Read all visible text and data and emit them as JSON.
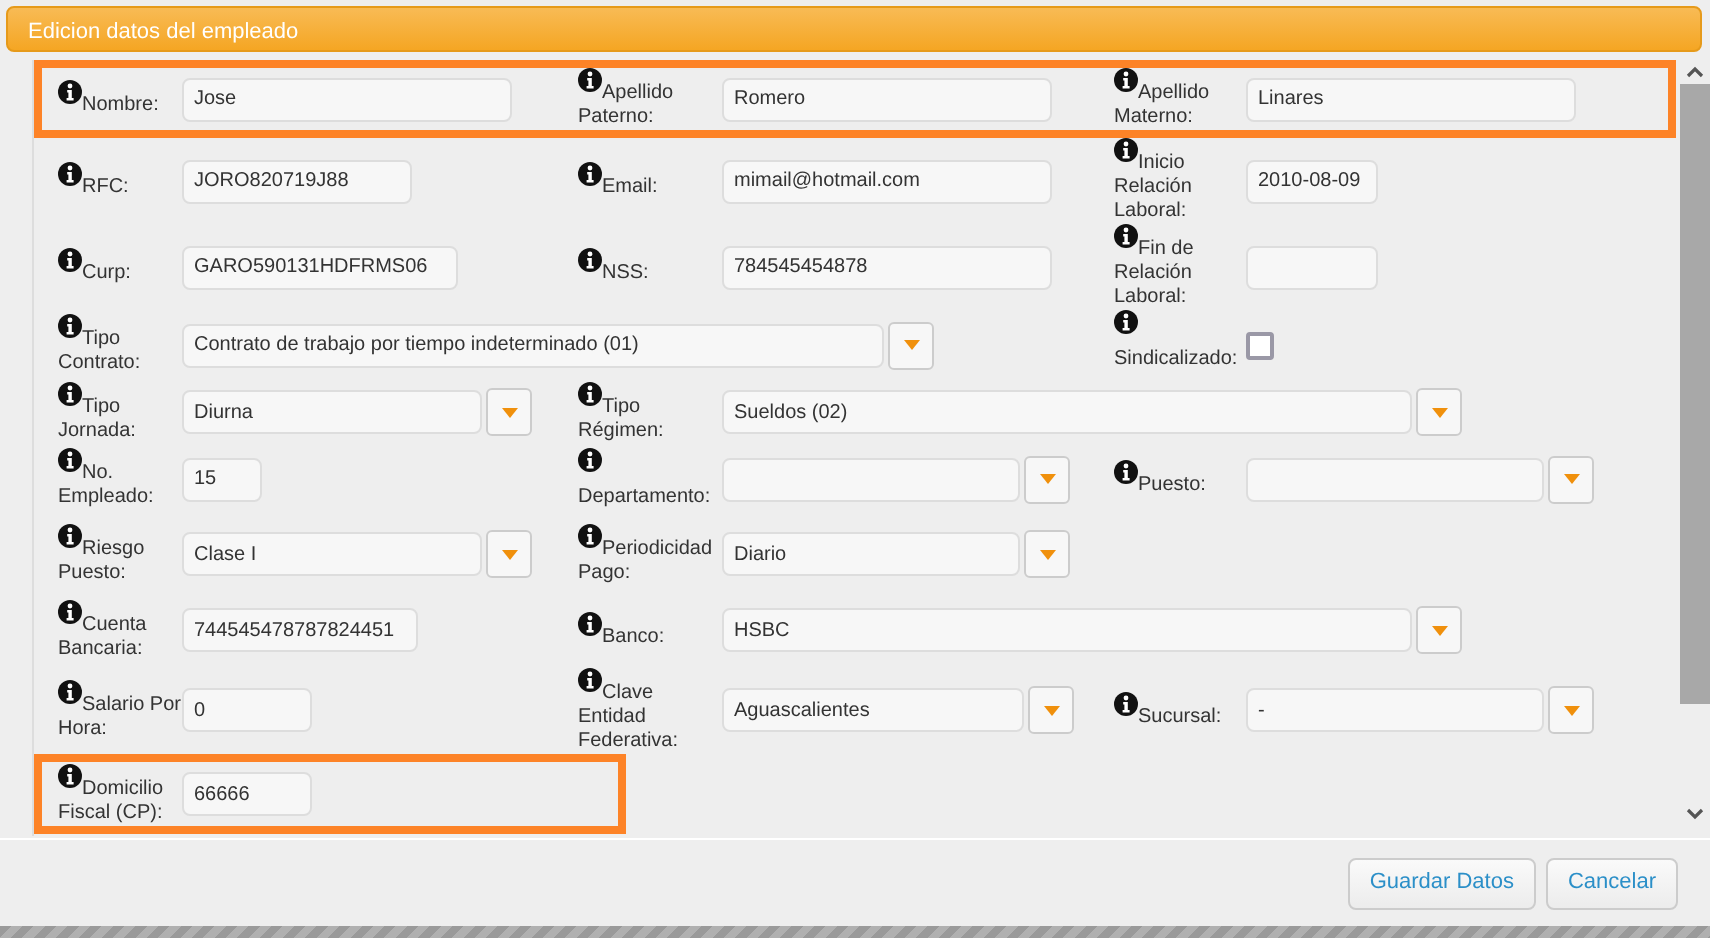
{
  "dialog": {
    "title": "Edicion datos del empleado"
  },
  "rows": [
    {
      "highlighted": true,
      "fields": [
        {
          "kind": "text",
          "label": "Nombre:",
          "value": "Jose"
        },
        {
          "kind": "text",
          "label": "Apellido Paterno:",
          "value": "Romero"
        },
        {
          "kind": "text",
          "label": "Apellido Materno:",
          "value": "Linares"
        }
      ]
    },
    {
      "highlighted": false,
      "fields": [
        {
          "kind": "text",
          "label": "RFC:",
          "value": "JORO820719J88"
        },
        {
          "kind": "text",
          "label": "Email:",
          "value": "mimail@hotmail.com"
        },
        {
          "kind": "text",
          "label": "Inicio Relación Laboral:",
          "value": "2010-08-09"
        }
      ]
    },
    {
      "highlighted": false,
      "fields": [
        {
          "kind": "text",
          "label": "Curp:",
          "value": "GARO590131HDFRMS06"
        },
        {
          "kind": "text",
          "label": "NSS:",
          "value": "784545454878"
        },
        {
          "kind": "text",
          "label": "Fin de Relación Laboral:"
        }
      ]
    },
    {
      "highlighted": false,
      "fields": [
        {
          "kind": "select",
          "label": "Tipo Contrato:",
          "value": "Contrato de trabajo por tiempo indeterminado (01)"
        },
        {
          "kind": "checkbox",
          "label": "Sindicalizado:",
          "checked": false
        }
      ]
    },
    {
      "highlighted": false,
      "fields": [
        {
          "kind": "select",
          "label": "Tipo Jornada:",
          "value": "Diurna"
        },
        {
          "kind": "select",
          "label": "Tipo Régimen:",
          "value": "Sueldos (02)"
        }
      ]
    },
    {
      "highlighted": false,
      "fields": [
        {
          "kind": "text",
          "label": "No. Empleado:",
          "value": "15"
        },
        {
          "kind": "select",
          "label": "Departamento:"
        },
        {
          "kind": "select",
          "label": "Puesto:"
        }
      ]
    },
    {
      "highlighted": false,
      "fields": [
        {
          "kind": "select",
          "label": "Riesgo Puesto:",
          "value": "Clase I"
        },
        {
          "kind": "select",
          "label": "Periodicidad Pago:",
          "value": "Diario"
        }
      ]
    },
    {
      "highlighted": false,
      "fields": [
        {
          "kind": "text",
          "label": "Cuenta Bancaria:",
          "value": "744545478787824451"
        },
        {
          "kind": "select",
          "label": "Banco:",
          "value": "HSBC"
        }
      ]
    },
    {
      "highlighted": false,
      "fields": [
        {
          "kind": "text",
          "label": "Salario Por Hora:",
          "value": "0"
        },
        {
          "kind": "select",
          "label": "Clave Entidad Federativa:",
          "value": "Aguascalientes"
        },
        {
          "kind": "select",
          "label": "Sucursal:",
          "value": "-"
        }
      ]
    },
    {
      "highlighted": true,
      "fields": [
        {
          "kind": "text",
          "label": "Domicilio Fiscal (CP):",
          "value": "66666"
        }
      ]
    }
  ],
  "buttons": [
    {
      "label": "Guardar Datos"
    },
    {
      "label": "Cancelar"
    }
  ]
}
